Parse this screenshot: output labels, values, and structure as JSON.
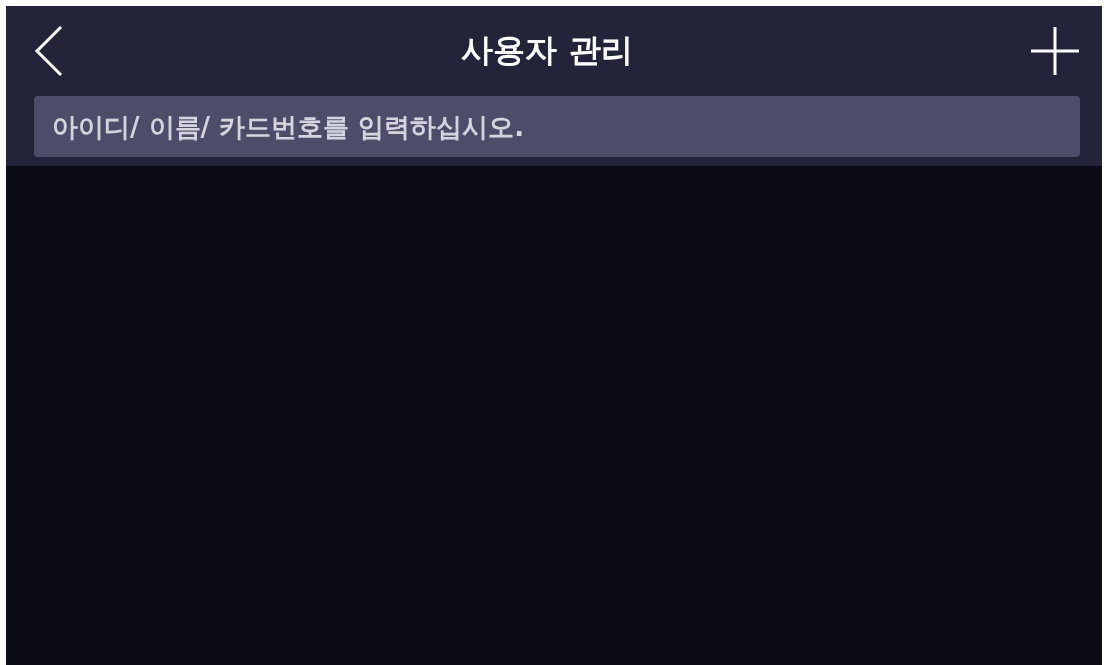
{
  "header": {
    "title": "사용자 관리"
  },
  "search": {
    "placeholder": "아이디/ 이름/ 카드번호를 입력하십시오."
  }
}
